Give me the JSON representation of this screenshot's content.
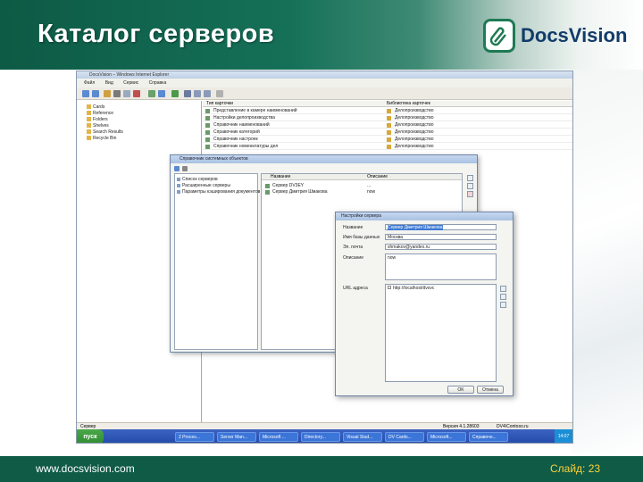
{
  "slide": {
    "title": "Каталог серверов",
    "logo_text": "DocsVision",
    "footer_url": "www.docsvision.com",
    "slide_number": "Слайд: 23",
    "colors": {
      "header_green": "#0d5a45",
      "footer_green": "#0f5b46",
      "slide_number": "#ffd23a"
    }
  },
  "app": {
    "window_title": "DocsVision – Windows Internet Explorer",
    "menu": [
      "Файл",
      "Вид",
      "Сервис",
      "Справка"
    ],
    "tree": [
      "Cards",
      "Reference",
      "Folders",
      "Shelves",
      "Search Results",
      "Recycle Bin"
    ],
    "list_headers": [
      "Тип карточки",
      "Библиотека карточек"
    ],
    "list_rows": [
      {
        "name": "Представление в камере наименований",
        "lib": "Делопроизводство"
      },
      {
        "name": "Настройки делопроизводства",
        "lib": "Делопроизводство"
      },
      {
        "name": "Справочник наименований",
        "lib": "Делопроизводство"
      },
      {
        "name": "Справочник категорий",
        "lib": "Делопроизводство"
      },
      {
        "name": "Справочник настроек",
        "lib": "Делопроизводство"
      },
      {
        "name": "Справочник номенклатуры дел",
        "lib": "Делопроизводство"
      }
    ],
    "status_left": "Сервер",
    "status_right": [
      "Версия 4.1.28603",
      "DV4\\Contoso.ru"
    ],
    "taskbar": {
      "start": "пуск",
      "tasks": [
        "2 Proces...",
        "Server Man...",
        "Microsoft ...",
        "Directory...",
        "Visual Stud...",
        "DV Cards...",
        "Microsoft...",
        "Справочн..."
      ],
      "clock": "14:07"
    }
  },
  "dialog1": {
    "title": "Справочник системных объектов",
    "nav": [
      "Список серверов",
      "Расширенные серверы",
      "Параметры кэширования документов"
    ],
    "headers": [
      "Название",
      "Описание"
    ],
    "rows": [
      {
        "name": "Сервер DV3EY",
        "desc": "..."
      },
      {
        "name": "Сервер Дмитрия Шмакова",
        "desc": "now"
      }
    ]
  },
  "dialog2": {
    "title": "Настройки сервера",
    "labels": {
      "name": "Название",
      "db": "Имя базы данных",
      "email": "Эл. почта",
      "desc": "Описание",
      "url": "URL адреса"
    },
    "values": {
      "name": "Сервер Дмитрия Шмакова",
      "db": "Москва",
      "email": "shmakov@yandex.ru",
      "desc": "now",
      "url": "http://localhost/dvsvc"
    },
    "ok": "OK",
    "cancel": "Отмена"
  }
}
